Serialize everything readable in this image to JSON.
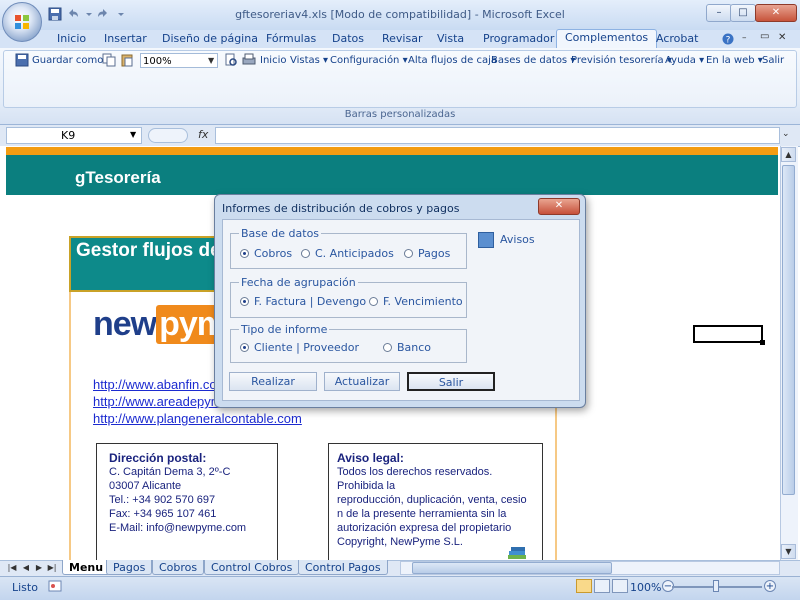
{
  "window": {
    "title": "gftesoreriav4.xls  [Modo de compatibilidad] - Microsoft Excel",
    "controls": [
      "–",
      "□",
      "✕"
    ]
  },
  "ribbon_tabs": [
    "Inicio",
    "Insertar",
    "Diseño de página",
    "Fórmulas",
    "Datos",
    "Revisar",
    "Vista",
    "Programador",
    "Complementos",
    "Acrobat"
  ],
  "ribbon_tabs_active": "Complementos",
  "toolbar": {
    "save_as": "Guardar como",
    "zoom": "100%",
    "inicio": "Inicio",
    "vistas": "Vistas ▾",
    "configuracion": "Configuración ▾",
    "alta_flujos": "Alta flujos de caja",
    "bases_datos": "Bases de datos ▾",
    "prevision": "Previsión tesorería ▾",
    "ayuda": "Ayuda ▾",
    "web": "En la web ▾",
    "salir": "Salir",
    "group_label": "Barras personalizadas"
  },
  "formula_bar": {
    "cell_ref": "K9",
    "fx": "fx",
    "formula": ""
  },
  "sheet": {
    "app_title": "gTesorería",
    "gestor_title": "Gestor flujos de caja",
    "logo_new": "new",
    "logo_pyme": "pyme",
    "links": [
      "http://www.abanfin.com",
      "http://www.areadepyme.com",
      "http://www.plangeneralcontable.com"
    ],
    "postal": {
      "heading": "Dirección postal:",
      "lines": [
        "C. Capitán  Dema 3, 2º-C",
        "03007 Alicante",
        "Tel.: +34 902 570 697",
        "Fax:  +34 965 107 461",
        "E-Mail: info@newpyme.com"
      ]
    },
    "legal": {
      "heading": "Aviso legal:",
      "lines": [
        "Todos los derechos reservados.",
        "Prohibida la",
        "reproducción, duplicación, venta, cesio",
        "n de la presente herramienta sin la",
        "autorización expresa del propietario",
        "Copyright, NewPyme S.L."
      ]
    }
  },
  "sheet_tabs": [
    "Menu",
    "Pagos",
    "Cobros",
    "Control Cobros",
    "Control Pagos"
  ],
  "sheet_tabs_active": "Menu",
  "status": {
    "text": "Listo",
    "zoom": "100%"
  },
  "dialog": {
    "title": "Informes de distribución de cobros y pagos",
    "close": "✕",
    "avisos": "Avisos",
    "group1": {
      "label": "Base de datos",
      "options": [
        "Cobros",
        "C. Anticipados",
        "Pagos"
      ],
      "selected": 0
    },
    "group2": {
      "label": "Fecha de agrupación",
      "options": [
        "F. Factura | Devengo",
        "F. Vencimiento"
      ],
      "selected": 0
    },
    "group3": {
      "label": "Tipo de informe",
      "options": [
        "Cliente | Proveedor",
        "Banco"
      ],
      "selected": 0
    },
    "buttons": {
      "realizar": "Realizar",
      "actualizar": "Actualizar",
      "salir": "Salir"
    }
  },
  "colors": {
    "teal": "#0b7f7f",
    "orange": "#f39c12",
    "ribbon": "#dfe8f5"
  }
}
